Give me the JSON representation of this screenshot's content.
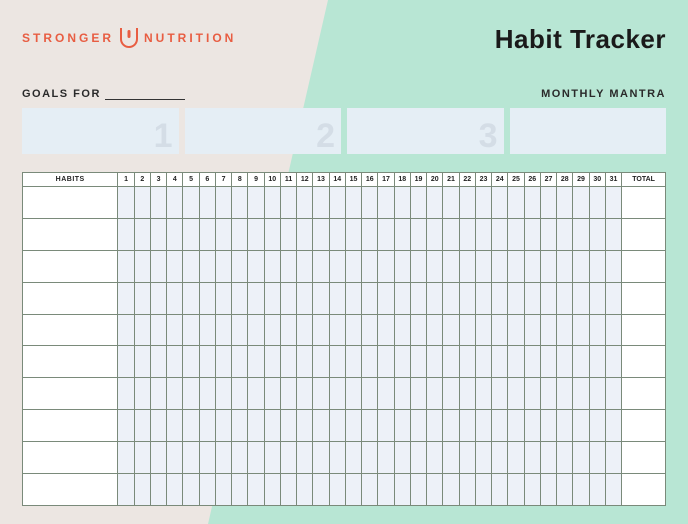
{
  "brand": {
    "left": "STRONGER",
    "right": "NUTRITION"
  },
  "title": "Habit Tracker",
  "goals_label": "GOALS FOR",
  "mantra_label": "MONTHLY MANTRA",
  "goal_boxes": [
    "1",
    "2",
    "3",
    ""
  ],
  "table": {
    "habits_header": "HABITS",
    "total_header": "TOTAL",
    "days": [
      "1",
      "2",
      "3",
      "4",
      "5",
      "6",
      "7",
      "8",
      "9",
      "10",
      "11",
      "12",
      "13",
      "14",
      "15",
      "16",
      "17",
      "18",
      "19",
      "20",
      "21",
      "22",
      "23",
      "24",
      "25",
      "26",
      "27",
      "28",
      "29",
      "30",
      "31"
    ],
    "rows": [
      "",
      "",
      "",
      "",
      "",
      "",
      "",
      "",
      "",
      ""
    ]
  }
}
